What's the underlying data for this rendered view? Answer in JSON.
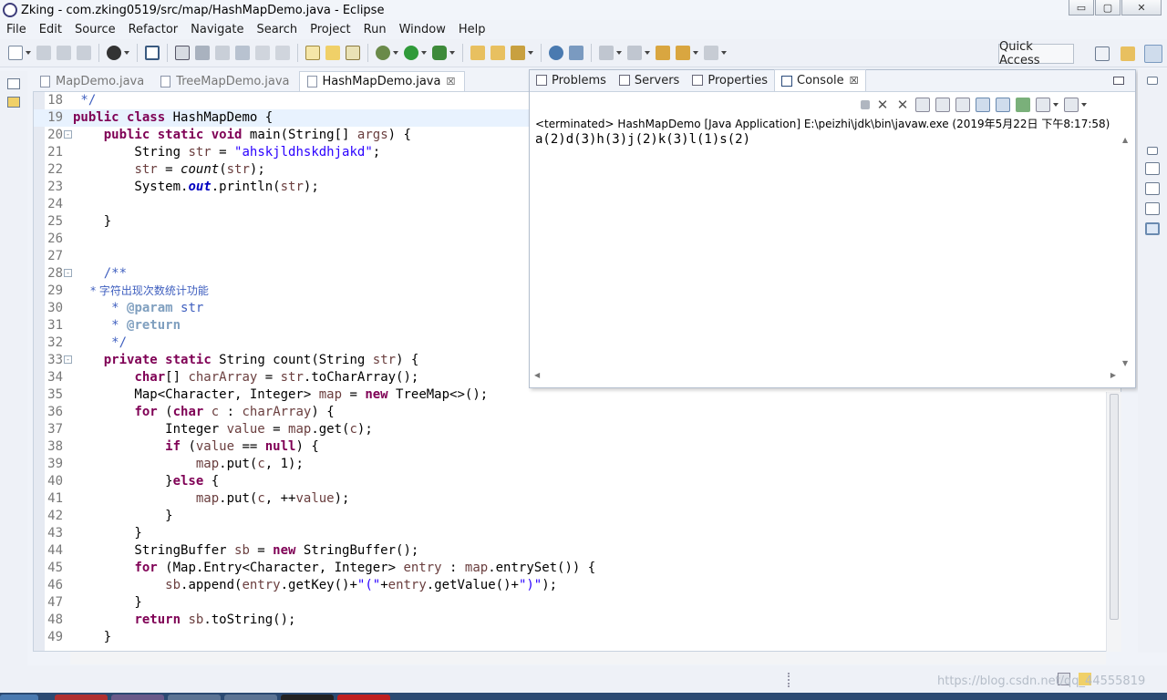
{
  "window": {
    "title": "Zking - com.zking0519/src/map/HashMapDemo.java - Eclipse",
    "controls": {
      "minimize": "▭",
      "maximize": "▢",
      "close": "✕"
    }
  },
  "menu": [
    "File",
    "Edit",
    "Source",
    "Refactor",
    "Navigate",
    "Search",
    "Project",
    "Run",
    "Window",
    "Help"
  ],
  "toolbar": {
    "quick_access": "Quick Access"
  },
  "editor": {
    "tabs": [
      {
        "label": "MapDemo.java",
        "active": false
      },
      {
        "label": "TreeMapDemo.java",
        "active": false
      },
      {
        "label": "HashMapDemo.java",
        "active": true,
        "close": "☒"
      }
    ],
    "lines": [
      {
        "n": "18",
        "text": " */"
      },
      {
        "n": "19",
        "text": "public class HashMapDemo {"
      },
      {
        "n": "20",
        "text": "    public static void main(String[] args) {"
      },
      {
        "n": "21",
        "text": "        String str = \"ahskjldhskdhjakd\";"
      },
      {
        "n": "22",
        "text": "        str = count(str);"
      },
      {
        "n": "23",
        "text": "        System.out.println(str);"
      },
      {
        "n": "24",
        "text": ""
      },
      {
        "n": "25",
        "text": "    }"
      },
      {
        "n": "26",
        "text": ""
      },
      {
        "n": "27",
        "text": ""
      },
      {
        "n": "28",
        "text": "    /**"
      },
      {
        "n": "29",
        "text": "     * 字符出现次数统计功能"
      },
      {
        "n": "30",
        "text": "     * @param str"
      },
      {
        "n": "31",
        "text": "     * @return"
      },
      {
        "n": "32",
        "text": "     */"
      },
      {
        "n": "33",
        "text": "    private static String count(String str) {"
      },
      {
        "n": "34",
        "text": "        char[] charArray = str.toCharArray();"
      },
      {
        "n": "35",
        "text": "        Map<Character, Integer> map = new TreeMap<>();"
      },
      {
        "n": "36",
        "text": "        for (char c : charArray) {"
      },
      {
        "n": "37",
        "text": "            Integer value = map.get(c);"
      },
      {
        "n": "38",
        "text": "            if (value == null) {"
      },
      {
        "n": "39",
        "text": "                map.put(c, 1);"
      },
      {
        "n": "40",
        "text": "            }else {"
      },
      {
        "n": "41",
        "text": "                map.put(c, ++value);"
      },
      {
        "n": "42",
        "text": "            }"
      },
      {
        "n": "43",
        "text": "        }"
      },
      {
        "n": "44",
        "text": "        StringBuffer sb = new StringBuffer();"
      },
      {
        "n": "45",
        "text": "        for (Map.Entry<Character, Integer> entry : map.entrySet()) {"
      },
      {
        "n": "46",
        "text": "            sb.append(entry.getKey()+\"(\"+entry.getValue()+\")\");"
      },
      {
        "n": "47",
        "text": "        }"
      },
      {
        "n": "48",
        "text": "        return sb.toString();"
      },
      {
        "n": "49",
        "text": "    }"
      }
    ]
  },
  "console": {
    "tabs": [
      {
        "label": "Problems",
        "active": false
      },
      {
        "label": "Servers",
        "active": false
      },
      {
        "label": "Properties",
        "active": false
      },
      {
        "label": "Console",
        "active": true,
        "close": "☒"
      }
    ],
    "status": "<terminated> HashMapDemo [Java Application] E:\\peizhi\\jdk\\bin\\javaw.exe (2019年5月22日 下午8:17:58)",
    "output": "a(2)d(3)h(3)j(2)k(3)l(1)s(2)"
  },
  "statusbar": {
    "watermark": "https://blog.csdn.net/qq_44555819"
  },
  "colors": {
    "keyword": "#7f0055",
    "string": "#2a00ff",
    "comment": "#3f5fbf",
    "field": "#0000c0"
  }
}
